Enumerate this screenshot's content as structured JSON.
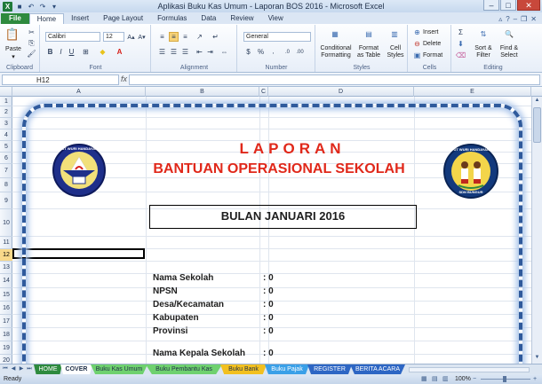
{
  "window": {
    "title": "Aplikasi Buku Kas Umum - Laporan BOS 2016  -  Microsoft Excel"
  },
  "ribbon_tabs": [
    "File",
    "Home",
    "Insert",
    "Page Layout",
    "Formulas",
    "Data",
    "Review",
    "View"
  ],
  "ribbon": {
    "clipboard": {
      "paste": "Paste",
      "label": "Clipboard"
    },
    "font": {
      "name": "Calibri",
      "size": "12",
      "label": "Font"
    },
    "alignment": {
      "label": "Alignment"
    },
    "number": {
      "format": "General",
      "label": "Number"
    },
    "styles": {
      "conditional": "Conditional",
      "conditional2": "Formatting",
      "format_table": "Format",
      "format_table2": "as Table",
      "cell_styles": "Cell",
      "cell_styles2": "Styles",
      "label": "Styles"
    },
    "cells": {
      "insert": "Insert",
      "delete": "Delete",
      "format": "Format",
      "label": "Cells"
    },
    "editing": {
      "sort": "Sort &",
      "sort2": "Filter",
      "find": "Find &",
      "find2": "Select",
      "label": "Editing"
    }
  },
  "formula_bar": {
    "name_box": "H12",
    "fx": "fx"
  },
  "columns": [
    "A",
    "B",
    "C",
    "D",
    "E"
  ],
  "rows": [
    "1",
    "2",
    "3",
    "4",
    "5",
    "6",
    "7",
    "8",
    "9",
    "10",
    "11",
    "12",
    "13",
    "14",
    "15",
    "16",
    "17",
    "18",
    "19",
    "20",
    "21"
  ],
  "selected_row": "12",
  "report": {
    "title": "LAPORAN",
    "subtitle": "BANTUAN OPERASIONAL SEKOLAH",
    "month": "BULAN JANUARI 2016",
    "fields": [
      {
        "label": "Nama Sekolah",
        "value": ": 0"
      },
      {
        "label": "NPSN",
        "value": ": 0"
      },
      {
        "label": "Desa/Kecamatan",
        "value": ": 0"
      },
      {
        "label": "Kabupaten",
        "value": ": 0"
      },
      {
        "label": "Provinsi",
        "value": ": 0"
      },
      {
        "label": "Nama Kepala Sekolah",
        "value": ": 0"
      }
    ],
    "logo_left_text": "TUT WURI HANDAYANI",
    "logo_right_text": "TUT WURI HANDAYANI",
    "logo_right_bottom": "SDN BUNGUR"
  },
  "sheet_tabs": [
    {
      "label": "HOME",
      "color": "#2e8a3e"
    },
    {
      "label": "COVER",
      "color": "#ffffff"
    },
    {
      "label": "Buku Kas Umum",
      "color": "#6fd16f"
    },
    {
      "label": "Buku Pembantu Kas",
      "color": "#6fd16f"
    },
    {
      "label": "Buku Bank",
      "color": "#f2c020"
    },
    {
      "label": "Buku Pajak",
      "color": "#3aa0e8"
    },
    {
      "label": "REGISTER",
      "color": "#2d66c4"
    },
    {
      "label": "BERITA ACARA",
      "color": "#2d66c4"
    }
  ],
  "status": {
    "ready": "Ready",
    "zoom": "100%"
  }
}
